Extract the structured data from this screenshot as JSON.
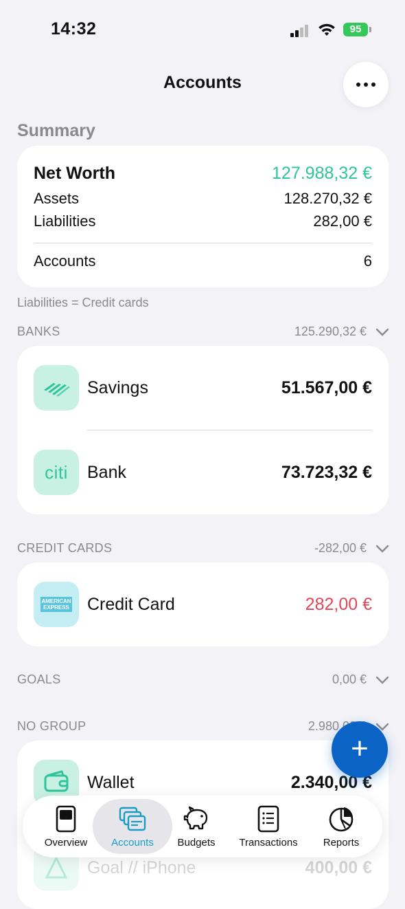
{
  "status": {
    "time": "14:32",
    "battery": "95"
  },
  "nav": {
    "title": "Accounts"
  },
  "summary": {
    "title": "Summary",
    "net_worth_label": "Net Worth",
    "net_worth_value": "127.988,32 €",
    "assets_label": "Assets",
    "assets_value": "128.270,32 €",
    "liabilities_label": "Liabilities",
    "liabilities_value": "282,00 €",
    "accounts_label": "Accounts",
    "accounts_value": "6",
    "note": "Liabilities = Credit cards"
  },
  "groups": {
    "banks": {
      "label": "BANKS",
      "total": "125.290,32 €",
      "accounts": [
        {
          "name": "Savings",
          "value": "51.567,00 €",
          "icon": "bank-of-america-icon"
        },
        {
          "name": "Bank",
          "value": "73.723,32 €",
          "icon": "citi-icon",
          "icon_text": "citi"
        }
      ]
    },
    "credit_cards": {
      "label": "CREDIT CARDS",
      "total": "-282,00 €",
      "accounts": [
        {
          "name": "Credit Card",
          "value": "282,00 €",
          "icon": "amex-icon",
          "icon_text": "AMERICAN EXPRESS"
        }
      ]
    },
    "goals": {
      "label": "GOALS",
      "total": "0,00 €"
    },
    "no_group": {
      "label": "NO GROUP",
      "total": "2.980,00 €",
      "accounts": [
        {
          "name": "Wallet",
          "value": "2.340,00 €",
          "icon": "wallet-icon"
        },
        {
          "name": "Goal // iPhone",
          "value": "400,00 €",
          "icon": "goal-icon"
        }
      ]
    }
  },
  "tabs": [
    {
      "label": "Overview",
      "icon": "overview-icon"
    },
    {
      "label": "Accounts",
      "icon": "accounts-icon"
    },
    {
      "label": "Budgets",
      "icon": "piggy-bank-icon"
    },
    {
      "label": "Transactions",
      "icon": "transactions-icon"
    },
    {
      "label": "Reports",
      "icon": "pie-chart-icon"
    }
  ],
  "colors": {
    "positive": "#2fc49a",
    "negative": "#e0485a",
    "accent": "#1a9bc4",
    "fab": "#0b63c5",
    "battery": "#34c759"
  }
}
